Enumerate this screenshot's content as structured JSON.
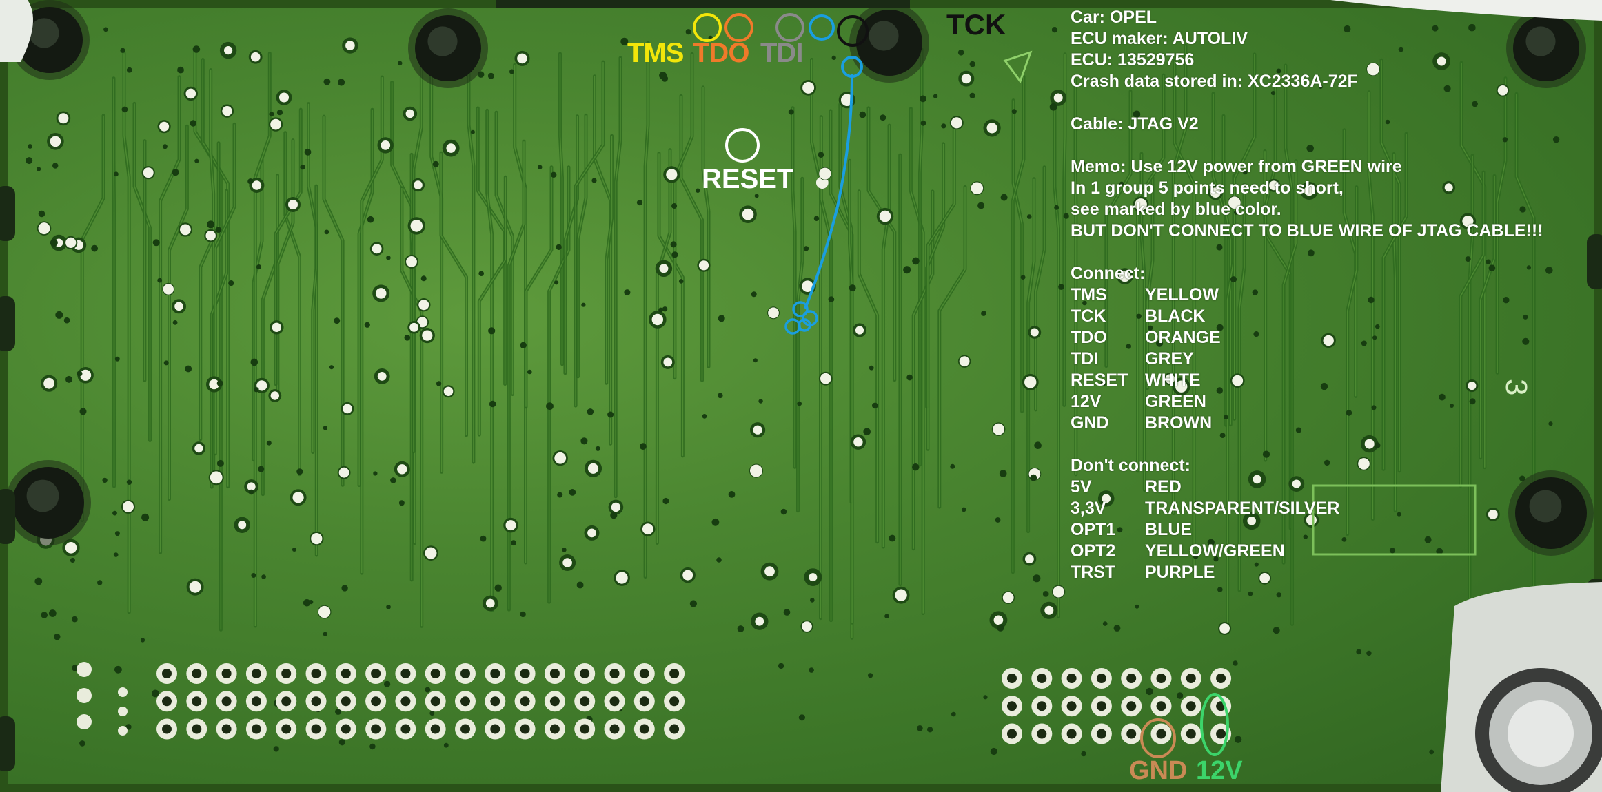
{
  "pin_labels": {
    "tms": {
      "text": "TMS",
      "color": "#f2e60a"
    },
    "tdo": {
      "text": "TDO",
      "color": "#f07a2a"
    },
    "tdi": {
      "text": "TDI",
      "color": "#8a8a8a"
    },
    "tck": {
      "text": "TCK",
      "color": "#111111"
    },
    "reset": {
      "text": "RESET",
      "color": "#ffffff"
    },
    "gnd": {
      "text": "GND",
      "color": "#c98a55"
    },
    "twelve_v": {
      "text": "12V",
      "color": "#3cd46a"
    }
  },
  "marker_colors": {
    "tms": "#f2e60a",
    "tdo": "#f07a2a",
    "tdi": "#8a8a8a",
    "tck": "#111111",
    "reset": "#ffffff",
    "short_group": "#1a9ee0",
    "gnd": "#c98a55",
    "twelve_v": "#3cd46a"
  },
  "info": {
    "car": "Car: OPEL",
    "maker": "ECU maker: AUTOLIV",
    "ecu": "ECU: 13529756",
    "crash": "Crash data stored in: XC2336A-72F",
    "cable": "Cable: JTAG V2",
    "memo_lines": [
      "Memo: Use 12V power from GREEN wire",
      "In 1 group 5 points need to short,",
      "see marked by blue color.",
      "BUT DON'T CONNECT TO BLUE WIRE OF JTAG CABLE!!!"
    ],
    "connect_title": "Connect:",
    "connect": [
      {
        "pin": "TMS",
        "wire": "YELLOW"
      },
      {
        "pin": "TCK",
        "wire": "BLACK"
      },
      {
        "pin": "TDO",
        "wire": "ORANGE"
      },
      {
        "pin": "TDI",
        "wire": "GREY"
      },
      {
        "pin": "RESET",
        "wire": "WHITE"
      },
      {
        "pin": "12V",
        "wire": "GREEN"
      },
      {
        "pin": "GND",
        "wire": "BROWN"
      }
    ],
    "dont_connect_title": "Don't connect:",
    "dont_connect": [
      {
        "pin": "5V",
        "wire": "RED"
      },
      {
        "pin": "3,3V",
        "wire": "TRANSPARENT/SILVER"
      },
      {
        "pin": "OPT1",
        "wire": "BLUE"
      },
      {
        "pin": "OPT2",
        "wire": "YELLOW/GREEN"
      },
      {
        "pin": "TRST",
        "wire": "PURPLE"
      }
    ]
  },
  "silkscreen": {
    "mark": "3"
  }
}
